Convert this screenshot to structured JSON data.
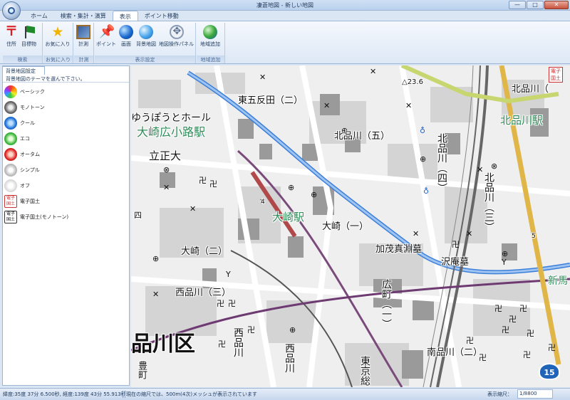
{
  "window": {
    "title": "凄蒼地図 - 新しい地図",
    "controls": {
      "minimize": "—",
      "maximize": "□",
      "close": "✕"
    }
  },
  "ribbon": {
    "tabs": [
      "ホーム",
      "検索・集計・演算",
      "表示",
      "ポイント移動"
    ],
    "active_tab": "表示",
    "groups": [
      {
        "label": "検索",
        "buttons": [
          {
            "label": "住所",
            "icon": "postal-mark-icon"
          },
          {
            "label": "目標物",
            "icon": "flag-icon"
          }
        ]
      },
      {
        "label": "お気に入り",
        "buttons": [
          {
            "label": "お気に入り",
            "icon": "star-icon"
          }
        ]
      },
      {
        "label": "計測",
        "buttons": [
          {
            "label": "計測",
            "icon": "measure-icon"
          }
        ]
      },
      {
        "label": "表示設定",
        "buttons": [
          {
            "label": "ポイント",
            "icon": "pin-icon"
          },
          {
            "label": "画面",
            "icon": "globe-icon"
          },
          {
            "label": "背景地図",
            "icon": "background-globe-icon"
          },
          {
            "label": "地図操作パネル",
            "icon": "navigation-icon"
          }
        ]
      },
      {
        "label": "地域追加",
        "buttons": [
          {
            "label": "地域追加",
            "icon": "add-region-globe-icon"
          }
        ]
      }
    ]
  },
  "panel": {
    "tab_label": "背景地図設定",
    "instruction": "背景地図のテーマを選んで下さい。",
    "themes": [
      "ベーシック",
      "モノトーン",
      "クール",
      "エコ",
      "オータム",
      "シンプル",
      "オフ",
      "電子国土",
      "電子国土(モノトーン)"
    ],
    "gsi_icon_text": "電子国土"
  },
  "map": {
    "labels": {
      "higashi_gotanda": "東五反田（二）",
      "kitashinagawa_1": "北品川（",
      "yuubou": "ゆうぽうとホール",
      "osakihirokoji": "大崎広小路駅",
      "kitashinagawa_5": "北品川（五）",
      "kitashinagawa_station": "北品川駅",
      "kitashinagawa_4": "北品川（四）",
      "kitashinagawa_3": "北品川（三）",
      "rissho": "立正大",
      "osaki_station": "大崎駅",
      "osaki_1": "大崎（一）",
      "osaki_2": "大崎（二）",
      "kamo": "加茂真淵墓",
      "takuan": "沢庵墓",
      "nishishinagawa_3": "西品川（三）",
      "hiromachi_1": "広町（一）",
      "shinagawa_ku": "品川区",
      "nishishinagawa": "西品川",
      "nishishinagawa_b": "西品川",
      "minamishinagawa": "南品川（二）",
      "toyomachi": "豊町",
      "tokyo": "東京総",
      "shinba": "新馬",
      "shi": "四",
      "elev": "△23.6",
      "km4": "4",
      "km5": "5"
    },
    "route_number": "15",
    "stamp_text": "電子国土"
  },
  "statusbar": {
    "coords": "緯度:35度 37分 6.500秒, 経度:139度 43分 55.913秒",
    "message": "現在の縮尺では、500m(4次)メッシュが表示されています",
    "scale_label": "表示縮尺：",
    "scale_value": "1/8800"
  }
}
